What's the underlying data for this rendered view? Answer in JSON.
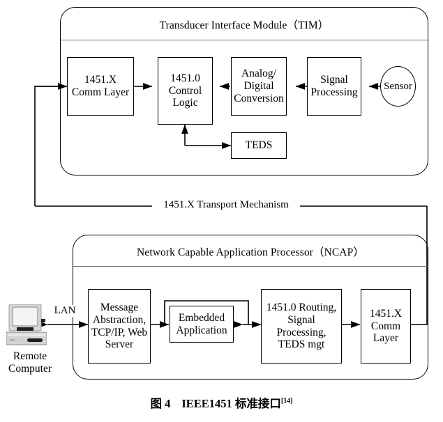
{
  "figure": {
    "caption_label": "图 4",
    "caption_title": "IEEE1451 标准接口",
    "caption_reference": "[14]"
  },
  "tim": {
    "title": "Transducer Interface Module（TIM）",
    "blocks": {
      "comm_layer": "1451.X\nComm Layer",
      "control_logic": "1451.0\nControl\nLogic",
      "adc": "Analog/\nDigital\nConversion",
      "signal_processing": "Signal\nProcessing",
      "teds": "TEDS",
      "sensor": "Sensor"
    }
  },
  "transport": {
    "label": "1451.X Transport Mechanism"
  },
  "ncap": {
    "title": "Network Capable Application Processor（NCAP）",
    "blocks": {
      "message_abstraction": "Message\nAbstraction,\nTCP/IP, Web\nServer",
      "embedded_application": "Embedded\nApplication",
      "routing": "1451.0 Routing,\nSignal\nProcessing,\nTEDS mgt",
      "comm_layer": "1451.X\nComm\nLayer"
    }
  },
  "remote": {
    "lan_label": "LAN",
    "caption": "Remote\nComputer"
  },
  "colors": {
    "stroke": "#000000",
    "rule": "#6f6f6f",
    "background": "#ffffff",
    "icon_light": "#d8d8d8",
    "icon_mid": "#a8a8a8",
    "icon_dark": "#2a2a2a"
  }
}
